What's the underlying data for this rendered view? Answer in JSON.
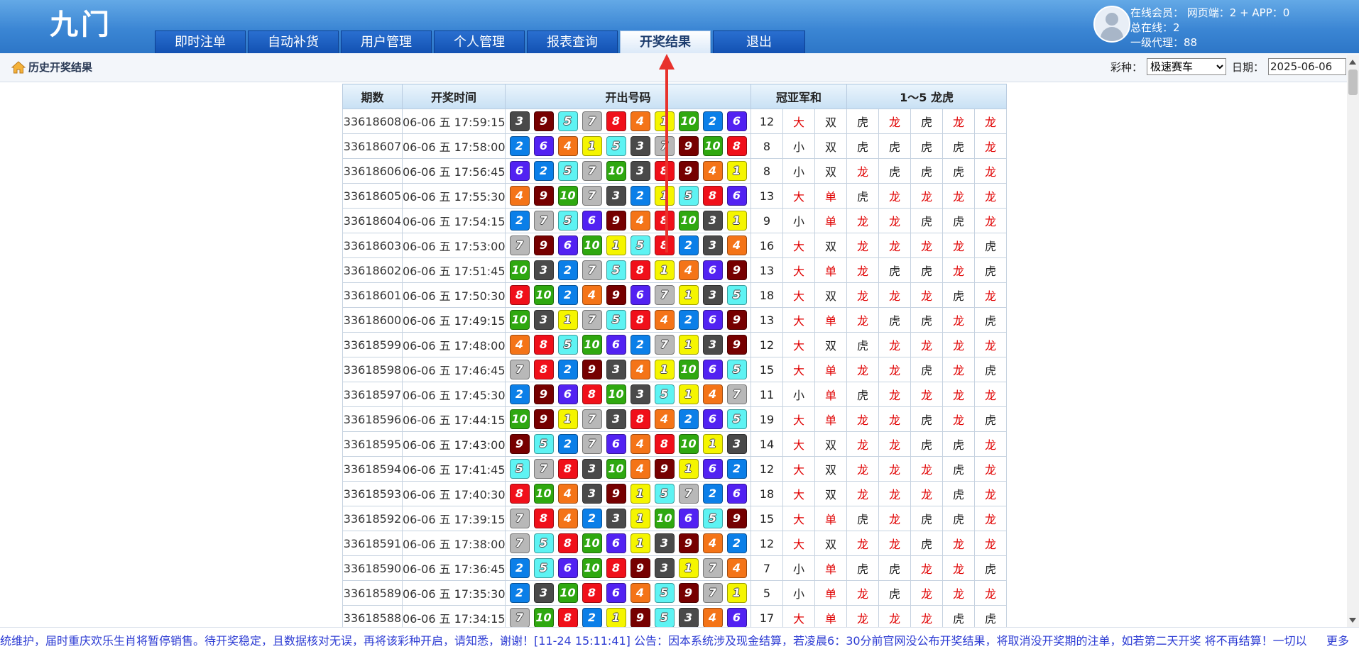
{
  "header": {
    "logo": "九门",
    "nav": [
      "即时注单",
      "自动补货",
      "用户管理",
      "个人管理",
      "报表查询",
      "开奖结果",
      "退出"
    ],
    "active_tab": "开奖结果",
    "stats": {
      "line1": "在线会员：  网页端：2 + APP：0",
      "line2": "总在线：2",
      "line3": "一级代理：88"
    }
  },
  "subbar": {
    "breadcrumb": "历史开奖结果",
    "lottery_label": "彩种：",
    "lottery_value": "极速赛车",
    "date_label": "日期：",
    "date_value": "2025-06-06"
  },
  "table": {
    "headers": [
      "期数",
      "开奖时间",
      "开出号码",
      "冠亚军和",
      "1～5 龙虎"
    ],
    "rows": [
      {
        "issue": "33618608",
        "time": "06-06 五 17:59:15",
        "balls": [
          3,
          9,
          5,
          7,
          8,
          4,
          1,
          10,
          2,
          6
        ],
        "sum": "12",
        "size": "大",
        "parity": "双",
        "lh": [
          "虎",
          "龙",
          "虎",
          "龙",
          "龙"
        ]
      },
      {
        "issue": "33618607",
        "time": "06-06 五 17:58:00",
        "balls": [
          2,
          6,
          4,
          1,
          5,
          3,
          7,
          9,
          10,
          8
        ],
        "sum": "8",
        "size": "小",
        "parity": "双",
        "lh": [
          "虎",
          "虎",
          "虎",
          "虎",
          "龙"
        ]
      },
      {
        "issue": "33618606",
        "time": "06-06 五 17:56:45",
        "balls": [
          6,
          2,
          5,
          7,
          10,
          3,
          8,
          9,
          4,
          1
        ],
        "sum": "8",
        "size": "小",
        "parity": "双",
        "lh": [
          "龙",
          "虎",
          "虎",
          "虎",
          "龙"
        ]
      },
      {
        "issue": "33618605",
        "time": "06-06 五 17:55:30",
        "balls": [
          4,
          9,
          10,
          7,
          3,
          2,
          1,
          5,
          8,
          6
        ],
        "sum": "13",
        "size": "大",
        "parity": "单",
        "lh": [
          "虎",
          "龙",
          "龙",
          "龙",
          "龙"
        ]
      },
      {
        "issue": "33618604",
        "time": "06-06 五 17:54:15",
        "balls": [
          2,
          7,
          5,
          6,
          9,
          4,
          8,
          10,
          3,
          1
        ],
        "sum": "9",
        "size": "小",
        "parity": "单",
        "lh": [
          "龙",
          "龙",
          "虎",
          "虎",
          "龙"
        ]
      },
      {
        "issue": "33618603",
        "time": "06-06 五 17:53:00",
        "balls": [
          7,
          9,
          6,
          10,
          1,
          5,
          8,
          2,
          3,
          4
        ],
        "sum": "16",
        "size": "大",
        "parity": "双",
        "lh": [
          "龙",
          "龙",
          "龙",
          "龙",
          "虎"
        ]
      },
      {
        "issue": "33618602",
        "time": "06-06 五 17:51:45",
        "balls": [
          10,
          3,
          2,
          7,
          5,
          8,
          1,
          4,
          6,
          9
        ],
        "sum": "13",
        "size": "大",
        "parity": "单",
        "lh": [
          "龙",
          "虎",
          "虎",
          "龙",
          "虎"
        ]
      },
      {
        "issue": "33618601",
        "time": "06-06 五 17:50:30",
        "balls": [
          8,
          10,
          2,
          4,
          9,
          6,
          7,
          1,
          3,
          5
        ],
        "sum": "18",
        "size": "大",
        "parity": "双",
        "lh": [
          "龙",
          "龙",
          "龙",
          "虎",
          "龙"
        ]
      },
      {
        "issue": "33618600",
        "time": "06-06 五 17:49:15",
        "balls": [
          10,
          3,
          1,
          7,
          5,
          8,
          4,
          2,
          6,
          9
        ],
        "sum": "13",
        "size": "大",
        "parity": "单",
        "lh": [
          "龙",
          "虎",
          "虎",
          "龙",
          "虎"
        ]
      },
      {
        "issue": "33618599",
        "time": "06-06 五 17:48:00",
        "balls": [
          4,
          8,
          5,
          10,
          6,
          2,
          7,
          1,
          3,
          9
        ],
        "sum": "12",
        "size": "大",
        "parity": "双",
        "lh": [
          "虎",
          "龙",
          "龙",
          "龙",
          "龙"
        ]
      },
      {
        "issue": "33618598",
        "time": "06-06 五 17:46:45",
        "balls": [
          7,
          8,
          2,
          9,
          3,
          4,
          1,
          10,
          6,
          5
        ],
        "sum": "15",
        "size": "大",
        "parity": "单",
        "lh": [
          "龙",
          "龙",
          "虎",
          "龙",
          "虎"
        ]
      },
      {
        "issue": "33618597",
        "time": "06-06 五 17:45:30",
        "balls": [
          2,
          9,
          6,
          8,
          10,
          3,
          5,
          1,
          4,
          7
        ],
        "sum": "11",
        "size": "小",
        "parity": "单",
        "lh": [
          "虎",
          "龙",
          "龙",
          "龙",
          "龙"
        ]
      },
      {
        "issue": "33618596",
        "time": "06-06 五 17:44:15",
        "balls": [
          10,
          9,
          1,
          7,
          3,
          8,
          4,
          2,
          6,
          5
        ],
        "sum": "19",
        "size": "大",
        "parity": "单",
        "lh": [
          "龙",
          "龙",
          "虎",
          "龙",
          "虎"
        ]
      },
      {
        "issue": "33618595",
        "time": "06-06 五 17:43:00",
        "balls": [
          9,
          5,
          2,
          7,
          6,
          4,
          8,
          10,
          1,
          3
        ],
        "sum": "14",
        "size": "大",
        "parity": "双",
        "lh": [
          "龙",
          "龙",
          "虎",
          "虎",
          "龙"
        ]
      },
      {
        "issue": "33618594",
        "time": "06-06 五 17:41:45",
        "balls": [
          5,
          7,
          8,
          3,
          10,
          4,
          9,
          1,
          6,
          2
        ],
        "sum": "12",
        "size": "大",
        "parity": "双",
        "lh": [
          "龙",
          "龙",
          "龙",
          "虎",
          "龙"
        ]
      },
      {
        "issue": "33618593",
        "time": "06-06 五 17:40:30",
        "balls": [
          8,
          10,
          4,
          3,
          9,
          1,
          5,
          7,
          2,
          6
        ],
        "sum": "18",
        "size": "大",
        "parity": "双",
        "lh": [
          "龙",
          "龙",
          "龙",
          "虎",
          "龙"
        ]
      },
      {
        "issue": "33618592",
        "time": "06-06 五 17:39:15",
        "balls": [
          7,
          8,
          4,
          2,
          3,
          1,
          10,
          6,
          5,
          9
        ],
        "sum": "15",
        "size": "大",
        "parity": "单",
        "lh": [
          "虎",
          "龙",
          "虎",
          "虎",
          "龙"
        ]
      },
      {
        "issue": "33618591",
        "time": "06-06 五 17:38:00",
        "balls": [
          7,
          5,
          8,
          10,
          6,
          1,
          3,
          9,
          4,
          2
        ],
        "sum": "12",
        "size": "大",
        "parity": "双",
        "lh": [
          "龙",
          "龙",
          "虎",
          "龙",
          "龙"
        ]
      },
      {
        "issue": "33618590",
        "time": "06-06 五 17:36:45",
        "balls": [
          2,
          5,
          6,
          10,
          8,
          9,
          3,
          1,
          7,
          4
        ],
        "sum": "7",
        "size": "小",
        "parity": "单",
        "lh": [
          "虎",
          "虎",
          "龙",
          "龙",
          "虎"
        ]
      },
      {
        "issue": "33618589",
        "time": "06-06 五 17:35:30",
        "balls": [
          2,
          3,
          10,
          8,
          6,
          4,
          5,
          9,
          7,
          1
        ],
        "sum": "5",
        "size": "小",
        "parity": "单",
        "lh": [
          "龙",
          "虎",
          "龙",
          "龙",
          "龙"
        ]
      },
      {
        "issue": "33618588",
        "time": "06-06 五 17:34:15",
        "balls": [
          7,
          10,
          8,
          2,
          1,
          9,
          5,
          3,
          4,
          6
        ],
        "sum": "17",
        "size": "大",
        "parity": "单",
        "lh": [
          "龙",
          "龙",
          "龙",
          "虎",
          "虎"
        ]
      }
    ]
  },
  "ball_colors": {
    "1": "#f5f500",
    "2": "#0b7fe8",
    "3": "#4a4a4a",
    "4": "#f47418",
    "5": "#5ef3f3",
    "6": "#5222f2",
    "7": "#b8b8b8",
    "8": "#f0101a",
    "9": "#760000",
    "10": "#2fa810"
  },
  "accent": {
    "red": "#e00000",
    "ticker": "#2c3bd3",
    "arrow": "#e8322c"
  },
  "ticker": {
    "text": "统维护，届时重庆欢乐生肖将暂停销售。待开奖稳定，且数据核对无误，再将该彩种开启，请知悉，谢谢！[11-24 15:11:41] 公告：因本系统涉及现金结算，若凌晨6：30分前官网没公布开奖结果，将取消没开奖期的注单，如若第二天开奖 将不再结算！一切以",
    "more": "更多"
  },
  "icons": {
    "breadcrumb": "home-icon",
    "avatar": "user-avatar-icon"
  }
}
